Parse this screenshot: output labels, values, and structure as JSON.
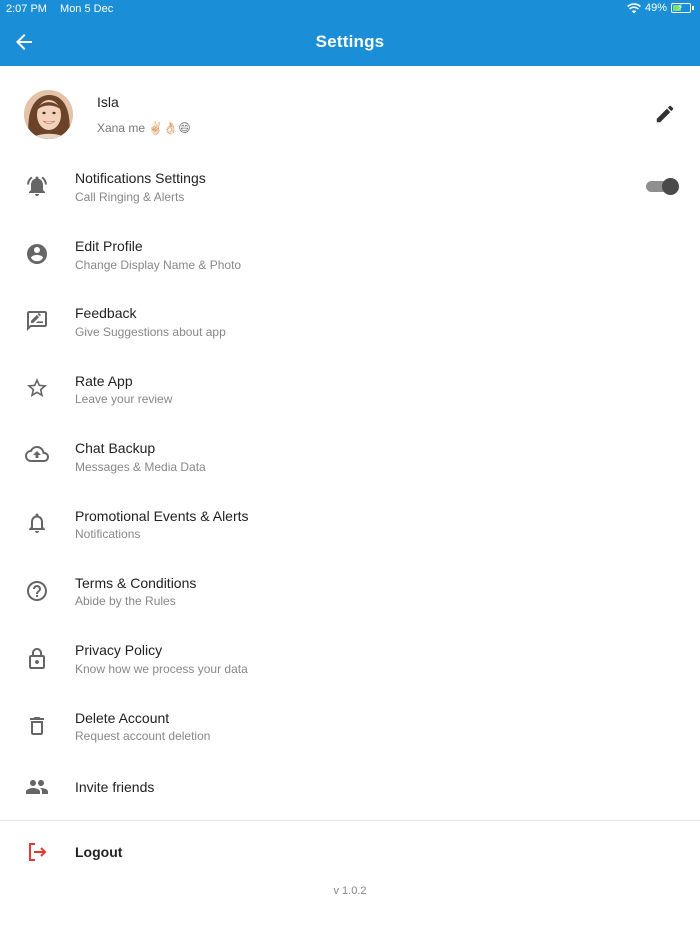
{
  "status_bar": {
    "time": "2:07 PM",
    "date": "Mon 5 Dec",
    "battery": "49%",
    "battery_level": 0.49
  },
  "header": {
    "title": "Settings",
    "back_icon": "arrow-left-icon",
    "color": "#1a8fd8"
  },
  "profile": {
    "name": "Isla",
    "status": "Xana me ✌🏻👌🏻😄",
    "edit_icon": "pencil-icon"
  },
  "menu": [
    {
      "title": "Notifications Settings",
      "subtitle": "Call Ringing & Alerts",
      "icon": "bell-ringing-icon",
      "toggle": true
    },
    {
      "title": "Edit Profile",
      "subtitle": "Change Display Name & Photo",
      "icon": "account-circle-icon"
    },
    {
      "title": "Feedback",
      "subtitle": "Give Suggestions about app",
      "icon": "feedback-icon"
    },
    {
      "title": "Rate App",
      "subtitle": "Leave your review",
      "icon": "star-icon"
    },
    {
      "title": "Chat Backup",
      "subtitle": "Messages & Media Data",
      "icon": "cloud-upload-icon"
    },
    {
      "title": "Promotional Events & Alerts",
      "subtitle": "Notifications",
      "icon": "bell-icon"
    },
    {
      "title": "Terms & Conditions",
      "subtitle": "Abide by the Rules",
      "icon": "help-circle-icon"
    },
    {
      "title": "Privacy Policy",
      "subtitle": "Know how we process your data",
      "icon": "lock-icon"
    },
    {
      "title": "Delete Account",
      "subtitle": "Request account deletion",
      "icon": "trash-icon"
    },
    {
      "title": "Invite friends",
      "icon": "people-icon"
    }
  ],
  "logout": {
    "label": "Logout",
    "icon": "logout-icon",
    "color": "#e53935"
  },
  "version": "v 1.0.2"
}
